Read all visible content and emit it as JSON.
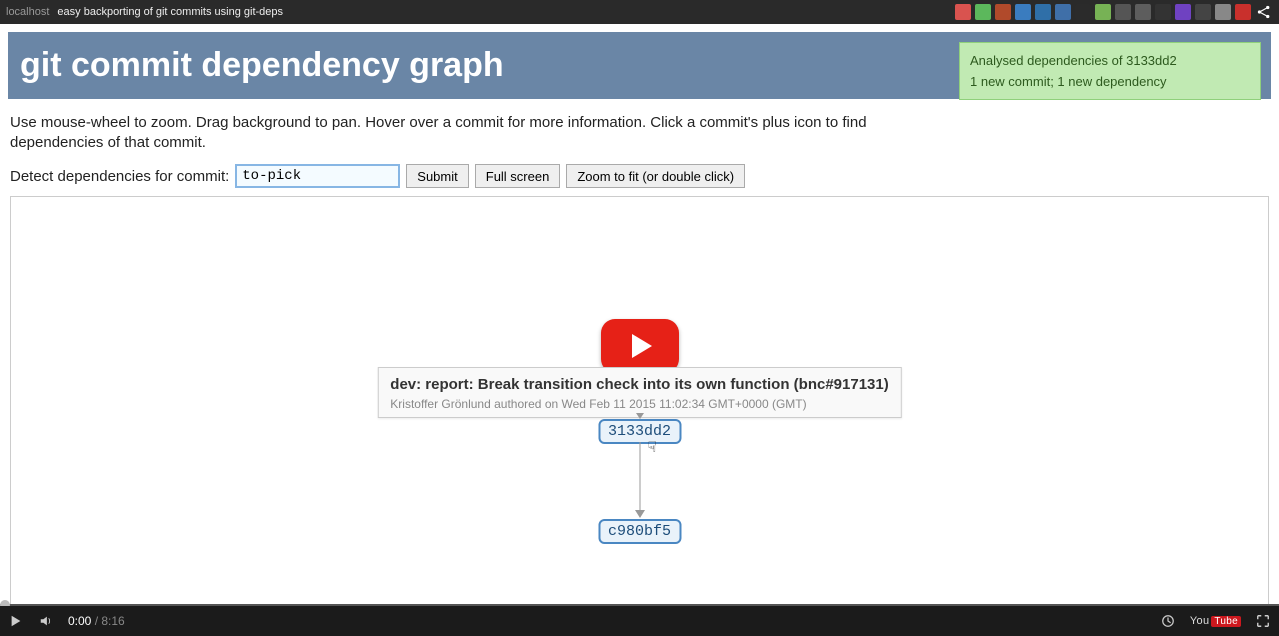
{
  "browser": {
    "url_host": "localhost",
    "video_title": "easy backporting of git commits using git-deps"
  },
  "header": {
    "title": "git commit dependency graph"
  },
  "status": {
    "line1": "Analysed dependencies of 3133dd2",
    "line2": "1 new commit; 1 new dependency"
  },
  "instructions": "Use mouse-wheel to zoom. Drag background to pan. Hover over a commit for more information. Click a commit's plus icon to find dependencies of that commit.",
  "controls": {
    "label": "Detect dependencies for commit:",
    "input_value": "to-pick",
    "submit": "Submit",
    "fullscreen": "Full screen",
    "zoomfit": "Zoom to fit (or double click)"
  },
  "tooltip": {
    "title": "dev: report: Break transition check into its own function (bnc#917131)",
    "meta": "Kristoffer Grönlund authored on Wed Feb 11 2015 11:02:34 GMT+0000 (GMT)"
  },
  "graph": {
    "top_commit": "3133dd2",
    "bottom_commit": "c980bf5"
  },
  "video": {
    "current": "0:00",
    "sep": " / ",
    "duration": "8:16",
    "youtube": "You",
    "youtube_tube": "Tube"
  }
}
